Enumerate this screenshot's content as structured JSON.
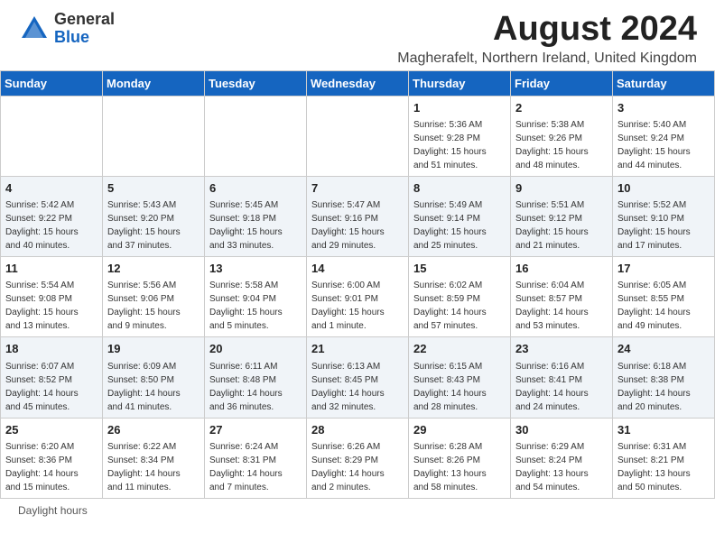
{
  "header": {
    "logo_general": "General",
    "logo_blue": "Blue",
    "month_title": "August 2024",
    "subtitle": "Magherafelt, Northern Ireland, United Kingdom"
  },
  "days_of_week": [
    "Sunday",
    "Monday",
    "Tuesday",
    "Wednesday",
    "Thursday",
    "Friday",
    "Saturday"
  ],
  "weeks": [
    [
      {
        "day": "",
        "info": ""
      },
      {
        "day": "",
        "info": ""
      },
      {
        "day": "",
        "info": ""
      },
      {
        "day": "",
        "info": ""
      },
      {
        "day": "1",
        "info": "Sunrise: 5:36 AM\nSunset: 9:28 PM\nDaylight: 15 hours\nand 51 minutes."
      },
      {
        "day": "2",
        "info": "Sunrise: 5:38 AM\nSunset: 9:26 PM\nDaylight: 15 hours\nand 48 minutes."
      },
      {
        "day": "3",
        "info": "Sunrise: 5:40 AM\nSunset: 9:24 PM\nDaylight: 15 hours\nand 44 minutes."
      }
    ],
    [
      {
        "day": "4",
        "info": "Sunrise: 5:42 AM\nSunset: 9:22 PM\nDaylight: 15 hours\nand 40 minutes."
      },
      {
        "day": "5",
        "info": "Sunrise: 5:43 AM\nSunset: 9:20 PM\nDaylight: 15 hours\nand 37 minutes."
      },
      {
        "day": "6",
        "info": "Sunrise: 5:45 AM\nSunset: 9:18 PM\nDaylight: 15 hours\nand 33 minutes."
      },
      {
        "day": "7",
        "info": "Sunrise: 5:47 AM\nSunset: 9:16 PM\nDaylight: 15 hours\nand 29 minutes."
      },
      {
        "day": "8",
        "info": "Sunrise: 5:49 AM\nSunset: 9:14 PM\nDaylight: 15 hours\nand 25 minutes."
      },
      {
        "day": "9",
        "info": "Sunrise: 5:51 AM\nSunset: 9:12 PM\nDaylight: 15 hours\nand 21 minutes."
      },
      {
        "day": "10",
        "info": "Sunrise: 5:52 AM\nSunset: 9:10 PM\nDaylight: 15 hours\nand 17 minutes."
      }
    ],
    [
      {
        "day": "11",
        "info": "Sunrise: 5:54 AM\nSunset: 9:08 PM\nDaylight: 15 hours\nand 13 minutes."
      },
      {
        "day": "12",
        "info": "Sunrise: 5:56 AM\nSunset: 9:06 PM\nDaylight: 15 hours\nand 9 minutes."
      },
      {
        "day": "13",
        "info": "Sunrise: 5:58 AM\nSunset: 9:04 PM\nDaylight: 15 hours\nand 5 minutes."
      },
      {
        "day": "14",
        "info": "Sunrise: 6:00 AM\nSunset: 9:01 PM\nDaylight: 15 hours\nand 1 minute."
      },
      {
        "day": "15",
        "info": "Sunrise: 6:02 AM\nSunset: 8:59 PM\nDaylight: 14 hours\nand 57 minutes."
      },
      {
        "day": "16",
        "info": "Sunrise: 6:04 AM\nSunset: 8:57 PM\nDaylight: 14 hours\nand 53 minutes."
      },
      {
        "day": "17",
        "info": "Sunrise: 6:05 AM\nSunset: 8:55 PM\nDaylight: 14 hours\nand 49 minutes."
      }
    ],
    [
      {
        "day": "18",
        "info": "Sunrise: 6:07 AM\nSunset: 8:52 PM\nDaylight: 14 hours\nand 45 minutes."
      },
      {
        "day": "19",
        "info": "Sunrise: 6:09 AM\nSunset: 8:50 PM\nDaylight: 14 hours\nand 41 minutes."
      },
      {
        "day": "20",
        "info": "Sunrise: 6:11 AM\nSunset: 8:48 PM\nDaylight: 14 hours\nand 36 minutes."
      },
      {
        "day": "21",
        "info": "Sunrise: 6:13 AM\nSunset: 8:45 PM\nDaylight: 14 hours\nand 32 minutes."
      },
      {
        "day": "22",
        "info": "Sunrise: 6:15 AM\nSunset: 8:43 PM\nDaylight: 14 hours\nand 28 minutes."
      },
      {
        "day": "23",
        "info": "Sunrise: 6:16 AM\nSunset: 8:41 PM\nDaylight: 14 hours\nand 24 minutes."
      },
      {
        "day": "24",
        "info": "Sunrise: 6:18 AM\nSunset: 8:38 PM\nDaylight: 14 hours\nand 20 minutes."
      }
    ],
    [
      {
        "day": "25",
        "info": "Sunrise: 6:20 AM\nSunset: 8:36 PM\nDaylight: 14 hours\nand 15 minutes."
      },
      {
        "day": "26",
        "info": "Sunrise: 6:22 AM\nSunset: 8:34 PM\nDaylight: 14 hours\nand 11 minutes."
      },
      {
        "day": "27",
        "info": "Sunrise: 6:24 AM\nSunset: 8:31 PM\nDaylight: 14 hours\nand 7 minutes."
      },
      {
        "day": "28",
        "info": "Sunrise: 6:26 AM\nSunset: 8:29 PM\nDaylight: 14 hours\nand 2 minutes."
      },
      {
        "day": "29",
        "info": "Sunrise: 6:28 AM\nSunset: 8:26 PM\nDaylight: 13 hours\nand 58 minutes."
      },
      {
        "day": "30",
        "info": "Sunrise: 6:29 AM\nSunset: 8:24 PM\nDaylight: 13 hours\nand 54 minutes."
      },
      {
        "day": "31",
        "info": "Sunrise: 6:31 AM\nSunset: 8:21 PM\nDaylight: 13 hours\nand 50 minutes."
      }
    ]
  ],
  "footer": {
    "daylight_label": "Daylight hours"
  }
}
